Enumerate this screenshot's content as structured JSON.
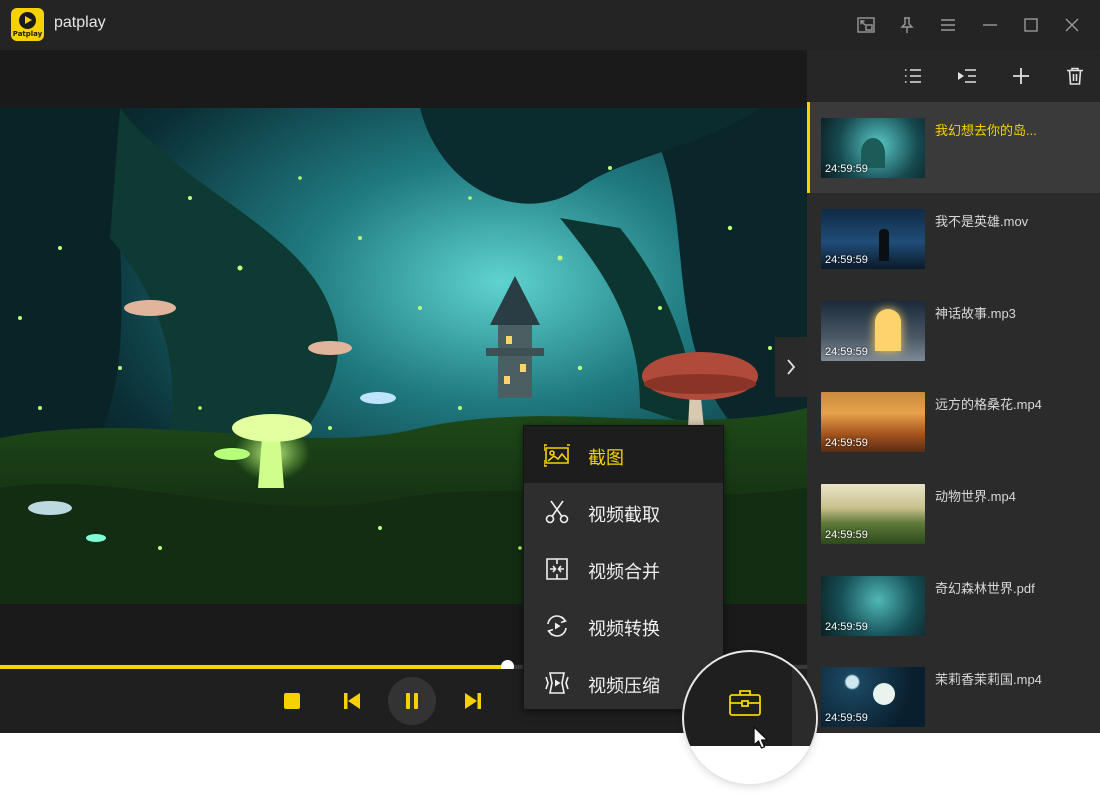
{
  "app": {
    "title": "patplay",
    "logo_text": "Patplay"
  },
  "window_controls": [
    "pip-icon",
    "pin-icon",
    "menu-icon",
    "minimize-icon",
    "maximize-icon",
    "close-icon"
  ],
  "sidebar": {
    "toolbar": [
      "list-icon",
      "play-list-icon",
      "add-icon",
      "delete-icon"
    ],
    "items": [
      {
        "name": "我幻想去你的岛...",
        "duration": "24:59:59",
        "active": true
      },
      {
        "name": "我不是英雄.mov",
        "duration": "24:59:59",
        "active": false
      },
      {
        "name": "神话故事.mp3",
        "duration": "24:59:59",
        "active": false
      },
      {
        "name": "远方的格桑花.mp4",
        "duration": "24:59:59",
        "active": false
      },
      {
        "name": "动物世界.mp4",
        "duration": "24:59:59",
        "active": false
      },
      {
        "name": "奇幻森林世界.pdf",
        "duration": "24:59:59",
        "active": false
      },
      {
        "name": "茉莉香茉莉国.mp4",
        "duration": "24:59:59",
        "active": false
      }
    ]
  },
  "player": {
    "progress": 0.628
  },
  "tools_menu": {
    "items": [
      {
        "label": "截图",
        "icon": "screenshot-icon",
        "active": true
      },
      {
        "label": "视频截取",
        "icon": "scissors-icon",
        "active": false
      },
      {
        "label": "视频合并",
        "icon": "merge-icon",
        "active": false
      },
      {
        "label": "视频转换",
        "icon": "convert-icon",
        "active": false
      },
      {
        "label": "视频压缩",
        "icon": "compress-icon",
        "active": false
      }
    ]
  },
  "colors": {
    "accent": "#f5d200",
    "background": "#1f1f1f",
    "sidebar": "#2b2b2b"
  }
}
